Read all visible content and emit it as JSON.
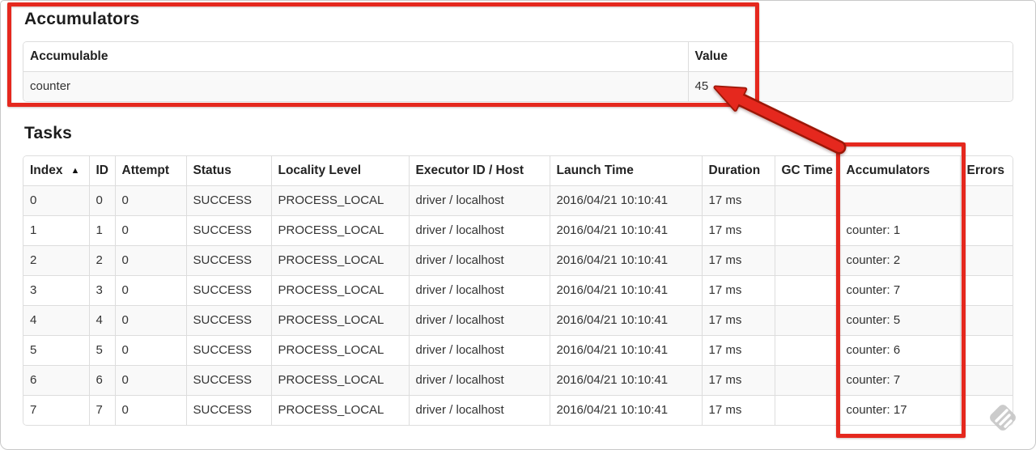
{
  "colors": {
    "annotation_red": "#e5281e",
    "annotation_red_dark": "#9d1707",
    "table_border": "#dddddd",
    "stripe_background": "#f9f9f9",
    "text": "#333333",
    "watermark_gray": "#c7c7c7"
  },
  "accumulators_section": {
    "title": "Accumulators",
    "table": {
      "headers": [
        "Accumulable",
        "Value"
      ],
      "rows": [
        [
          "counter",
          "45"
        ]
      ]
    }
  },
  "tasks_section": {
    "title": "Tasks",
    "table": {
      "headers": [
        "Index",
        "ID",
        "Attempt",
        "Status",
        "Locality Level",
        "Executor ID / Host",
        "Launch Time",
        "Duration",
        "GC Time",
        "Accumulators",
        "Errors"
      ],
      "sort_indicator": "▲",
      "sorted_column": "Index",
      "rows": [
        [
          "0",
          "0",
          "0",
          "SUCCESS",
          "PROCESS_LOCAL",
          "driver / localhost",
          "2016/04/21 10:10:41",
          "17 ms",
          "",
          "",
          ""
        ],
        [
          "1",
          "1",
          "0",
          "SUCCESS",
          "PROCESS_LOCAL",
          "driver / localhost",
          "2016/04/21 10:10:41",
          "17 ms",
          "",
          "counter: 1",
          ""
        ],
        [
          "2",
          "2",
          "0",
          "SUCCESS",
          "PROCESS_LOCAL",
          "driver / localhost",
          "2016/04/21 10:10:41",
          "17 ms",
          "",
          "counter: 2",
          ""
        ],
        [
          "3",
          "3",
          "0",
          "SUCCESS",
          "PROCESS_LOCAL",
          "driver / localhost",
          "2016/04/21 10:10:41",
          "17 ms",
          "",
          "counter: 7",
          ""
        ],
        [
          "4",
          "4",
          "0",
          "SUCCESS",
          "PROCESS_LOCAL",
          "driver / localhost",
          "2016/04/21 10:10:41",
          "17 ms",
          "",
          "counter: 5",
          ""
        ],
        [
          "5",
          "5",
          "0",
          "SUCCESS",
          "PROCESS_LOCAL",
          "driver / localhost",
          "2016/04/21 10:10:41",
          "17 ms",
          "",
          "counter: 6",
          ""
        ],
        [
          "6",
          "6",
          "0",
          "SUCCESS",
          "PROCESS_LOCAL",
          "driver / localhost",
          "2016/04/21 10:10:41",
          "17 ms",
          "",
          "counter: 7",
          ""
        ],
        [
          "7",
          "7",
          "0",
          "SUCCESS",
          "PROCESS_LOCAL",
          "driver / localhost",
          "2016/04/21 10:10:41",
          "17 ms",
          "",
          "counter: 17",
          ""
        ]
      ]
    }
  },
  "annotations": {
    "box_1_target": "accumulators-summary-table",
    "box_2_target": "tasks-accumulators-column",
    "arrow_points_to": "45"
  }
}
